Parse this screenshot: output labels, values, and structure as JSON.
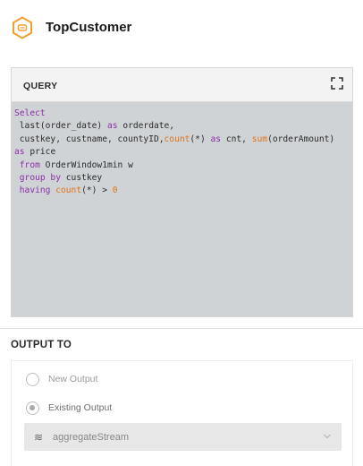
{
  "header": {
    "title": "TopCustomer",
    "icon": "hexagon-node-icon"
  },
  "query": {
    "label": "QUERY",
    "expand_icon": "fullscreen-icon",
    "lines": [
      [
        {
          "t": "Select",
          "c": "kw"
        }
      ],
      [
        {
          "t": " last",
          "c": ""
        },
        {
          "t": "(order_date) ",
          "c": ""
        },
        {
          "t": "as",
          "c": "kw"
        },
        {
          "t": " orderdate,",
          "c": ""
        }
      ],
      [
        {
          "t": " custkey, custname, countyID,",
          "c": ""
        },
        {
          "t": "count",
          "c": "fn"
        },
        {
          "t": "(*) ",
          "c": ""
        },
        {
          "t": "as",
          "c": "kw"
        },
        {
          "t": " cnt, ",
          "c": ""
        },
        {
          "t": "sum",
          "c": "fn"
        },
        {
          "t": "(orderAmount)",
          "c": ""
        }
      ],
      [
        {
          "t": "as",
          "c": "kw"
        },
        {
          "t": " price",
          "c": ""
        }
      ],
      [
        {
          "t": " ",
          "c": ""
        },
        {
          "t": "from",
          "c": "kw"
        },
        {
          "t": " OrderWindow1min w",
          "c": ""
        }
      ],
      [
        {
          "t": " ",
          "c": ""
        },
        {
          "t": "group by",
          "c": "kw"
        },
        {
          "t": " custkey",
          "c": ""
        }
      ],
      [
        {
          "t": " ",
          "c": ""
        },
        {
          "t": "having",
          "c": "kw"
        },
        {
          "t": " ",
          "c": ""
        },
        {
          "t": "count",
          "c": "fn"
        },
        {
          "t": "(*) > ",
          "c": ""
        },
        {
          "t": "0",
          "c": "fn"
        }
      ]
    ]
  },
  "output": {
    "title": "OUTPUT TO",
    "options": [
      {
        "label": "New Output",
        "checked": false
      },
      {
        "label": "Existing Output",
        "checked": true
      }
    ],
    "select": {
      "icon": "stream-icon",
      "value": "aggregateStream"
    }
  },
  "colors": {
    "keyword": "#8b2fa6",
    "function": "#e0741a",
    "editor_bg": "#cfd3d6",
    "logo": "#f0a030"
  }
}
